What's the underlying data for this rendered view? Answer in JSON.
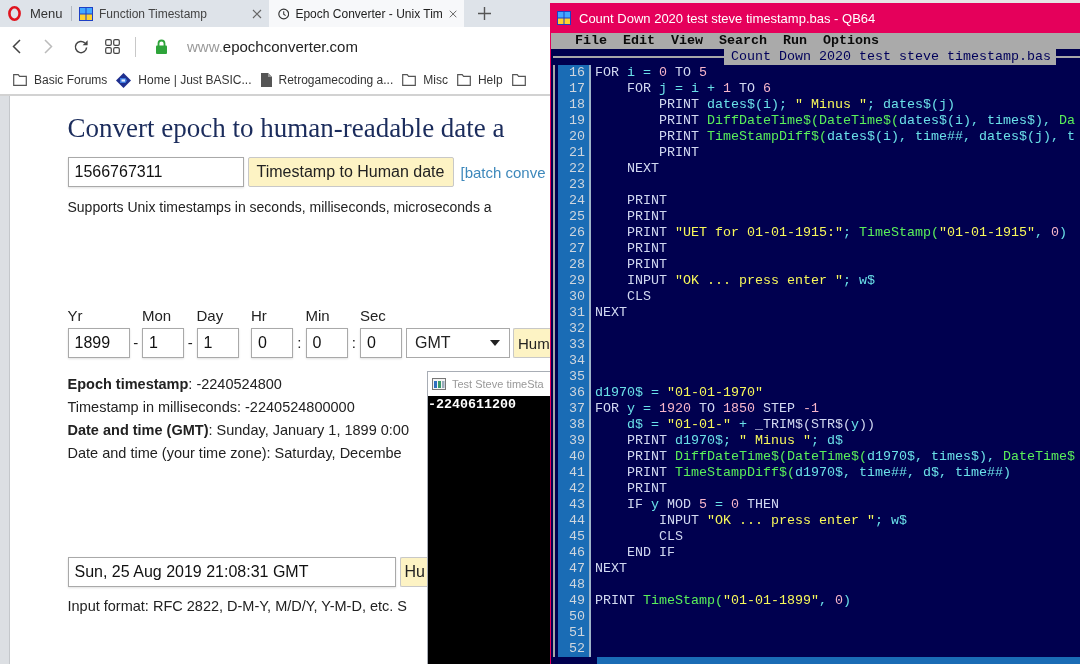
{
  "browser": {
    "menu_button": {
      "label": "Menu"
    },
    "tabs": [
      {
        "title": "Function Timestamp",
        "selected": false
      },
      {
        "title": "Epoch Converter - Unix Tim",
        "selected": true
      }
    ],
    "toolbar": {
      "forward_disabled": true
    },
    "address": {
      "prefix": "www.",
      "domain": "epochconverter.com"
    },
    "bookmarks": [
      {
        "kind": "folder",
        "label": "Basic Forums"
      },
      {
        "kind": "site",
        "label": "Home | Just BASIC..."
      },
      {
        "kind": "page",
        "label": "Retrogamecoding a..."
      },
      {
        "kind": "folder",
        "label": "Misc"
      },
      {
        "kind": "folder",
        "label": "Help"
      },
      {
        "kind": "folder"
      }
    ]
  },
  "page": {
    "heading": "Convert epoch to human-readable date a",
    "timestamp_input": {
      "value": "1566767311"
    },
    "convert_button": "Timestamp to Human date",
    "batch_link": "[batch conve",
    "note": "Supports Unix timestamps in seconds, milliseconds, microseconds a",
    "date_fields": [
      {
        "label": "Yr",
        "value": "1899"
      },
      {
        "label": "Mon",
        "value": "1",
        "separator_before": "-"
      },
      {
        "label": "Day",
        "value": "1",
        "separator_before": "-"
      },
      {
        "label": "Hr",
        "value": "0"
      },
      {
        "label": "Min",
        "value": "0",
        "separator_before": ":"
      },
      {
        "label": "Sec",
        "value": "0",
        "separator_before": ":"
      }
    ],
    "timezone_select": {
      "value": "GMT"
    },
    "human_date_button": "Hum",
    "results": [
      "**Epoch timestamp**: -2240524800",
      "Timestamp in milliseconds: -2240524800000",
      "**Date and time (GMT)**: Sunday, January 1, 1899 0:00",
      "Date and time (your time zone): Saturday, Decembe"
    ],
    "date_input": {
      "value": "Sun, 25 Aug 2019 21:08:31 GMT"
    },
    "date_button": "Hu",
    "format_note": "Input format: RFC 2822, D-M-Y, M/D/Y, Y-M-D, etc. S"
  },
  "console": {
    "title": "Test Steve timeSta",
    "output": [
      "-2240611200"
    ]
  },
  "editor": {
    "title": "Count Down 2020 test steve timestamp.bas - QB64",
    "menu": [
      "File",
      "Edit",
      "View",
      "Search",
      "Run",
      "Options"
    ],
    "file_tab": "Count Down 2020 test steve timestamp.bas",
    "lines": [
      {
        "number": "16",
        "tokens": [
          {
            "kind": "keyword",
            "text": "FOR"
          },
          {
            "kind": "text",
            "text": " i = "
          },
          {
            "kind": "number",
            "text": "0"
          },
          {
            "kind": "keyword",
            "text": " TO "
          },
          {
            "kind": "number",
            "text": "5"
          }
        ]
      },
      {
        "number": "17",
        "tokens": [
          {
            "kind": "keyword",
            "text": "    FOR"
          },
          {
            "kind": "text",
            "text": " j = i + "
          },
          {
            "kind": "number",
            "text": "1"
          },
          {
            "kind": "keyword",
            "text": " TO "
          },
          {
            "kind": "number",
            "text": "6"
          }
        ]
      },
      {
        "number": "18",
        "tokens": [
          {
            "kind": "keyword",
            "text": "        PRINT"
          },
          {
            "kind": "text",
            "text": " dates$(i); "
          },
          {
            "kind": "string",
            "text": "\" Minus \""
          },
          {
            "kind": "text",
            "text": "; dates$(j)"
          }
        ]
      },
      {
        "number": "19",
        "tokens": [
          {
            "kind": "keyword",
            "text": "        PRINT "
          },
          {
            "kind": "function",
            "text": "DiffDateTime$(DateTime$("
          },
          {
            "kind": "text",
            "text": "dates$(i), times$), "
          },
          {
            "kind": "function",
            "text": "Da"
          }
        ]
      },
      {
        "number": "20",
        "tokens": [
          {
            "kind": "keyword",
            "text": "        PRINT "
          },
          {
            "kind": "function",
            "text": "TimeStampDiff$("
          },
          {
            "kind": "text",
            "text": "dates$(i), time##, dates$(j), t"
          }
        ]
      },
      {
        "number": "21",
        "tokens": [
          {
            "kind": "keyword",
            "text": "        PRINT"
          }
        ]
      },
      {
        "number": "22",
        "tokens": [
          {
            "kind": "keyword",
            "text": "    NEXT"
          }
        ]
      },
      {
        "number": "23"
      },
      {
        "number": "24",
        "tokens": [
          {
            "kind": "keyword",
            "text": "    PRINT"
          }
        ]
      },
      {
        "number": "25",
        "tokens": [
          {
            "kind": "keyword",
            "text": "    PRINT"
          }
        ]
      },
      {
        "number": "26",
        "tokens": [
          {
            "kind": "keyword",
            "text": "    PRINT "
          },
          {
            "kind": "string",
            "text": "\"UET for 01-01-1915:\""
          },
          {
            "kind": "text",
            "text": "; "
          },
          {
            "kind": "function",
            "text": "TimeStamp("
          },
          {
            "kind": "string",
            "text": "\"01-01-1915\""
          },
          {
            "kind": "text",
            "text": ", "
          },
          {
            "kind": "number",
            "text": "0"
          },
          {
            "kind": "text",
            "text": ")"
          }
        ]
      },
      {
        "number": "27",
        "tokens": [
          {
            "kind": "keyword",
            "text": "    PRINT"
          }
        ]
      },
      {
        "number": "28",
        "tokens": [
          {
            "kind": "keyword",
            "text": "    PRINT"
          }
        ]
      },
      {
        "number": "29",
        "tokens": [
          {
            "kind": "keyword",
            "text": "    INPUT "
          },
          {
            "kind": "string",
            "text": "\"OK ... press enter \""
          },
          {
            "kind": "text",
            "text": "; w$"
          }
        ]
      },
      {
        "number": "30",
        "tokens": [
          {
            "kind": "keyword",
            "text": "    CLS"
          }
        ]
      },
      {
        "number": "31",
        "tokens": [
          {
            "kind": "keyword",
            "text": "NEXT"
          }
        ]
      },
      {
        "number": "32"
      },
      {
        "number": "33"
      },
      {
        "number": "34"
      },
      {
        "number": "35"
      },
      {
        "number": "36",
        "tokens": [
          {
            "kind": "text",
            "text": "d1970$ = "
          },
          {
            "kind": "string",
            "text": "\"01-01-1970\""
          }
        ]
      },
      {
        "number": "37",
        "tokens": [
          {
            "kind": "keyword",
            "text": "FOR"
          },
          {
            "kind": "text",
            "text": " y = "
          },
          {
            "kind": "number",
            "text": "1920"
          },
          {
            "kind": "keyword",
            "text": " TO "
          },
          {
            "kind": "number",
            "text": "1850"
          },
          {
            "kind": "keyword",
            "text": " STEP "
          },
          {
            "kind": "number",
            "text": "-1"
          }
        ]
      },
      {
        "number": "38",
        "tokens": [
          {
            "kind": "text",
            "text": "    d$ = "
          },
          {
            "kind": "string",
            "text": "\"01-01-\""
          },
          {
            "kind": "text",
            "text": " + "
          },
          {
            "kind": "keyword",
            "text": "_TRIM$(STR$("
          },
          {
            "kind": "text",
            "text": "y"
          },
          {
            "kind": "keyword",
            "text": "))"
          }
        ]
      },
      {
        "number": "39",
        "tokens": [
          {
            "kind": "keyword",
            "text": "    PRINT "
          },
          {
            "kind": "text",
            "text": "d1970$; "
          },
          {
            "kind": "string",
            "text": "\" Minus \""
          },
          {
            "kind": "text",
            "text": "; d$"
          }
        ]
      },
      {
        "number": "40",
        "tokens": [
          {
            "kind": "keyword",
            "text": "    PRINT "
          },
          {
            "kind": "function",
            "text": "DiffDateTime$(DateTime$("
          },
          {
            "kind": "text",
            "text": "d1970$, times$), "
          },
          {
            "kind": "function",
            "text": "DateTime$"
          }
        ]
      },
      {
        "number": "41",
        "tokens": [
          {
            "kind": "keyword",
            "text": "    PRINT "
          },
          {
            "kind": "function",
            "text": "TimeStampDiff$("
          },
          {
            "kind": "text",
            "text": "d1970$, time##, d$, time##)"
          }
        ]
      },
      {
        "number": "42",
        "tokens": [
          {
            "kind": "keyword",
            "text": "    PRINT"
          }
        ]
      },
      {
        "number": "43",
        "tokens": [
          {
            "kind": "keyword",
            "text": "    IF "
          },
          {
            "kind": "text",
            "text": "y "
          },
          {
            "kind": "keyword",
            "text": "MOD "
          },
          {
            "kind": "number",
            "text": "5"
          },
          {
            "kind": "text",
            "text": " = "
          },
          {
            "kind": "number",
            "text": "0"
          },
          {
            "kind": "keyword",
            "text": " THEN"
          }
        ]
      },
      {
        "number": "44",
        "tokens": [
          {
            "kind": "keyword",
            "text": "        INPUT "
          },
          {
            "kind": "string",
            "text": "\"OK ... press enter \""
          },
          {
            "kind": "text",
            "text": "; w$"
          }
        ]
      },
      {
        "number": "45",
        "tokens": [
          {
            "kind": "keyword",
            "text": "        CLS"
          }
        ]
      },
      {
        "number": "46",
        "tokens": [
          {
            "kind": "keyword",
            "text": "    END IF"
          }
        ]
      },
      {
        "number": "47",
        "tokens": [
          {
            "kind": "keyword",
            "text": "NEXT"
          }
        ]
      },
      {
        "number": "48"
      },
      {
        "number": "49",
        "tokens": [
          {
            "kind": "keyword",
            "text": "PRINT "
          },
          {
            "kind": "function",
            "text": "TimeStamp("
          },
          {
            "kind": "string",
            "text": "\"01-01-1899\""
          },
          {
            "kind": "text",
            "text": ", "
          },
          {
            "kind": "number",
            "text": "0"
          },
          {
            "kind": "text",
            "text": ")"
          }
        ]
      },
      {
        "number": "50"
      },
      {
        "number": "51"
      },
      {
        "number": "52"
      }
    ]
  }
}
